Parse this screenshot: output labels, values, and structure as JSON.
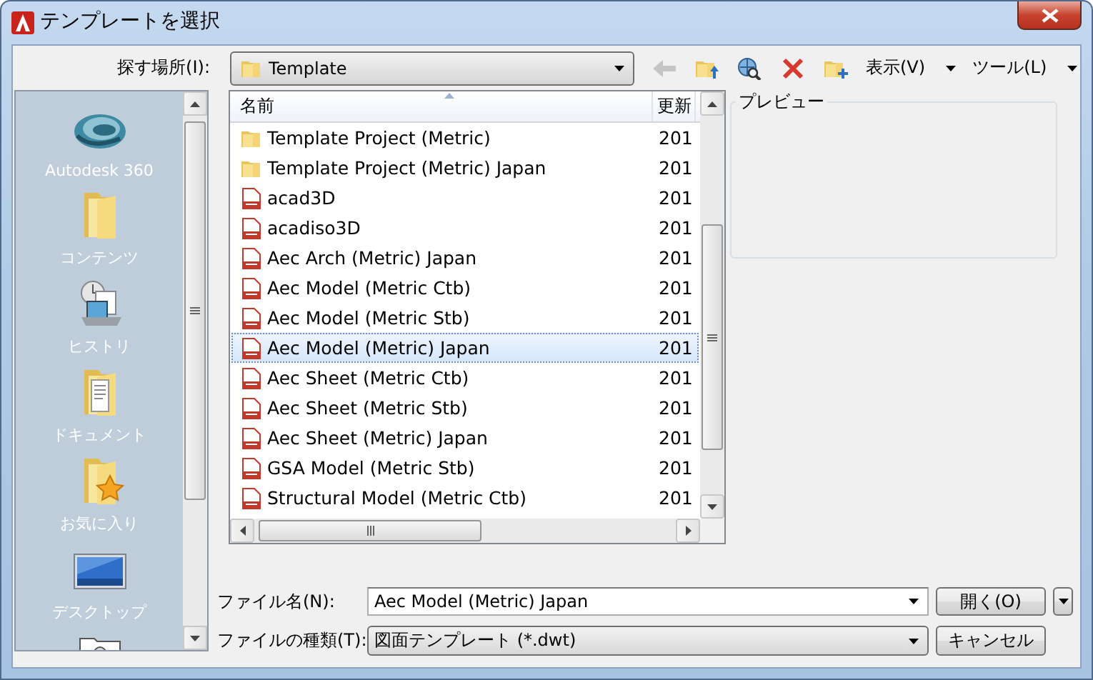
{
  "window": {
    "title": "テンプレートを選択"
  },
  "look_in": {
    "label": "探す場所(I):",
    "value": "Template"
  },
  "toolbar": [
    {
      "kind": "back",
      "disabled": true
    },
    {
      "kind": "up_folder",
      "disabled": false
    },
    {
      "kind": "search_web",
      "disabled": false
    },
    {
      "kind": "delete",
      "disabled": false
    },
    {
      "kind": "new_folder",
      "disabled": false
    },
    {
      "kind": "menu",
      "label": "表示(V)",
      "disabled": false
    },
    {
      "kind": "menu",
      "label": "ツール(L)",
      "disabled": false
    }
  ],
  "places": [
    {
      "kind": "cloud",
      "label": "Autodesk 360"
    },
    {
      "kind": "folder",
      "label": "コンテンツ"
    },
    {
      "kind": "history",
      "label": "ヒストリ"
    },
    {
      "kind": "documents",
      "label": "ドキュメント"
    },
    {
      "kind": "favorites",
      "label": "お気に入り"
    },
    {
      "kind": "desktop",
      "label": "デスクトップ"
    },
    {
      "kind": "computer"
    }
  ],
  "file_list": {
    "columns": [
      "名前",
      "更新"
    ],
    "rows": [
      {
        "kind": "folder",
        "name": "Template Project (Metric)",
        "date": "201",
        "selected": false
      },
      {
        "kind": "folder",
        "name": "Template Project (Metric) Japan",
        "date": "201",
        "selected": false
      },
      {
        "kind": "dwt",
        "name": "acad3D",
        "date": "201",
        "selected": false
      },
      {
        "kind": "dwt",
        "name": "acadiso3D",
        "date": "201",
        "selected": false
      },
      {
        "kind": "dwt",
        "name": "Aec Arch (Metric) Japan",
        "date": "201",
        "selected": false
      },
      {
        "kind": "dwt",
        "name": "Aec Model (Metric Ctb)",
        "date": "201",
        "selected": false
      },
      {
        "kind": "dwt",
        "name": "Aec Model (Metric Stb)",
        "date": "201",
        "selected": false
      },
      {
        "kind": "dwt",
        "name": "Aec Model (Metric) Japan",
        "date": "201",
        "selected": true
      },
      {
        "kind": "dwt",
        "name": "Aec Sheet (Metric Ctb)",
        "date": "201",
        "selected": false
      },
      {
        "kind": "dwt",
        "name": "Aec Sheet (Metric Stb)",
        "date": "201",
        "selected": false
      },
      {
        "kind": "dwt",
        "name": "Aec Sheet (Metric) Japan",
        "date": "201",
        "selected": false
      },
      {
        "kind": "dwt",
        "name": "GSA Model (Metric Stb)",
        "date": "201",
        "selected": false
      },
      {
        "kind": "dwt",
        "name": "Structural Model (Metric Ctb)",
        "date": "201",
        "selected": false
      }
    ]
  },
  "preview": {
    "label": "プレビュー"
  },
  "file_name": {
    "label": "ファイル名(N):",
    "value": "Aec Model (Metric) Japan"
  },
  "file_type": {
    "label": "ファイルの種類(T):",
    "value": "図面テンプレート (*.dwt)"
  },
  "buttons": [
    {
      "label": "開く(O)"
    },
    {
      "label": "キャンセル"
    }
  ]
}
